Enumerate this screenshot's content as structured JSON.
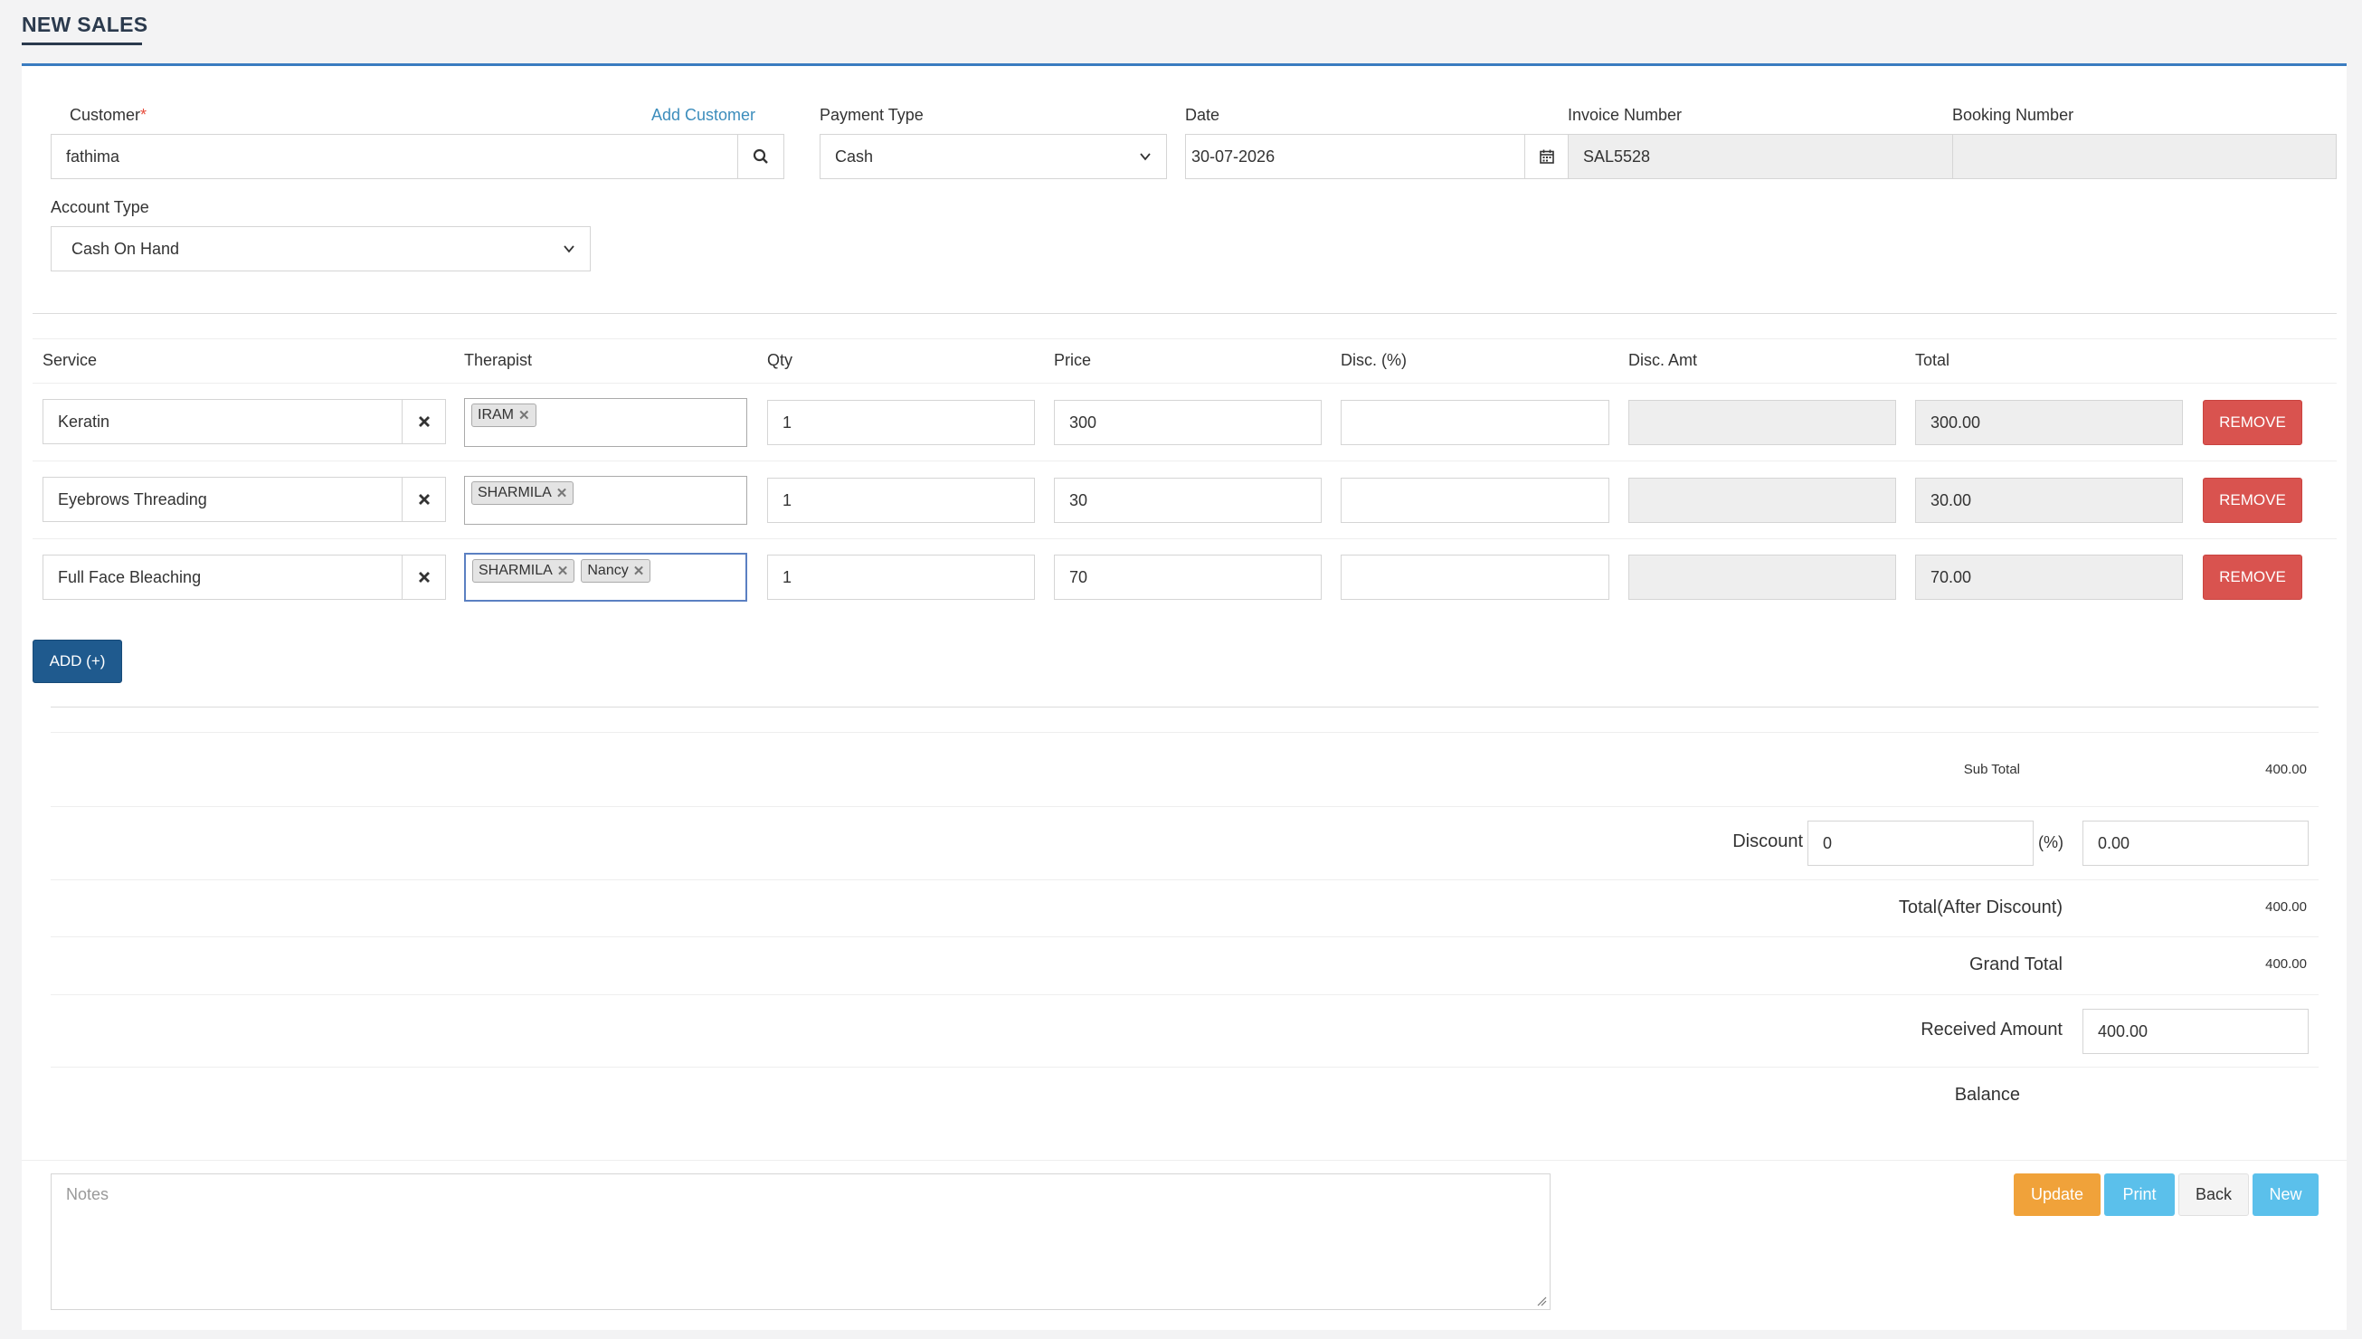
{
  "page": {
    "title": "NEW SALES"
  },
  "form": {
    "customer": {
      "label": "Customer",
      "required_mark": "*",
      "add_link": "Add Customer",
      "value": "fathima"
    },
    "payment_type": {
      "label": "Payment Type",
      "value": "Cash"
    },
    "date": {
      "label": "Date",
      "value": "30-07-2026"
    },
    "invoice_number": {
      "label": "Invoice Number",
      "value": "SAL5528"
    },
    "booking_number": {
      "label": "Booking Number",
      "value": ""
    },
    "account_type": {
      "label": "Account Type",
      "value": "Cash On Hand"
    }
  },
  "table": {
    "headers": {
      "service": "Service",
      "therapist": "Therapist",
      "qty": "Qty",
      "price": "Price",
      "disc_pct": "Disc. (%)",
      "disc_amt": "Disc. Amt",
      "total": "Total"
    },
    "rows": [
      {
        "service": "Keratin",
        "therapists": [
          "IRAM"
        ],
        "qty": "1",
        "price": "300",
        "disc_pct": "",
        "disc_amt": "",
        "total": "300.00",
        "remove": "REMOVE"
      },
      {
        "service": "Eyebrows Threading",
        "therapists": [
          "SHARMILA"
        ],
        "qty": "1",
        "price": "30",
        "disc_pct": "",
        "disc_amt": "",
        "total": "30.00",
        "remove": "REMOVE"
      },
      {
        "service": "Full Face Bleaching",
        "therapists": [
          "SHARMILA",
          "Nancy"
        ],
        "qty": "1",
        "price": "70",
        "disc_pct": "",
        "disc_amt": "",
        "total": "70.00",
        "remove": "REMOVE"
      }
    ],
    "add_button": "ADD (+)"
  },
  "summary": {
    "sub_total_label": "Sub Total",
    "sub_total": "400.00",
    "discount_label": "Discount",
    "discount_pct": "0",
    "pct_symbol": "(%)",
    "discount_amt": "0.00",
    "after_discount_label": "Total(After Discount)",
    "after_discount": "400.00",
    "grand_total_label": "Grand Total",
    "grand_total": "400.00",
    "received_label": "Received Amount",
    "received": "400.00",
    "balance_label": "Balance"
  },
  "notes": {
    "placeholder": "Notes"
  },
  "actions": {
    "update": "Update",
    "print": "Print",
    "back": "Back",
    "new": "New"
  },
  "icons": {
    "search": "search-icon",
    "calendar": "calendar-icon",
    "clear": "close-icon",
    "dropdown": "chevron-down-icon",
    "tag_remove": "close-icon"
  },
  "colors": {
    "primary": "#1f5a8e",
    "remove": "#d9534f",
    "update": "#f0a23a",
    "info": "#5bc0eb",
    "link": "#3c8dbc"
  }
}
